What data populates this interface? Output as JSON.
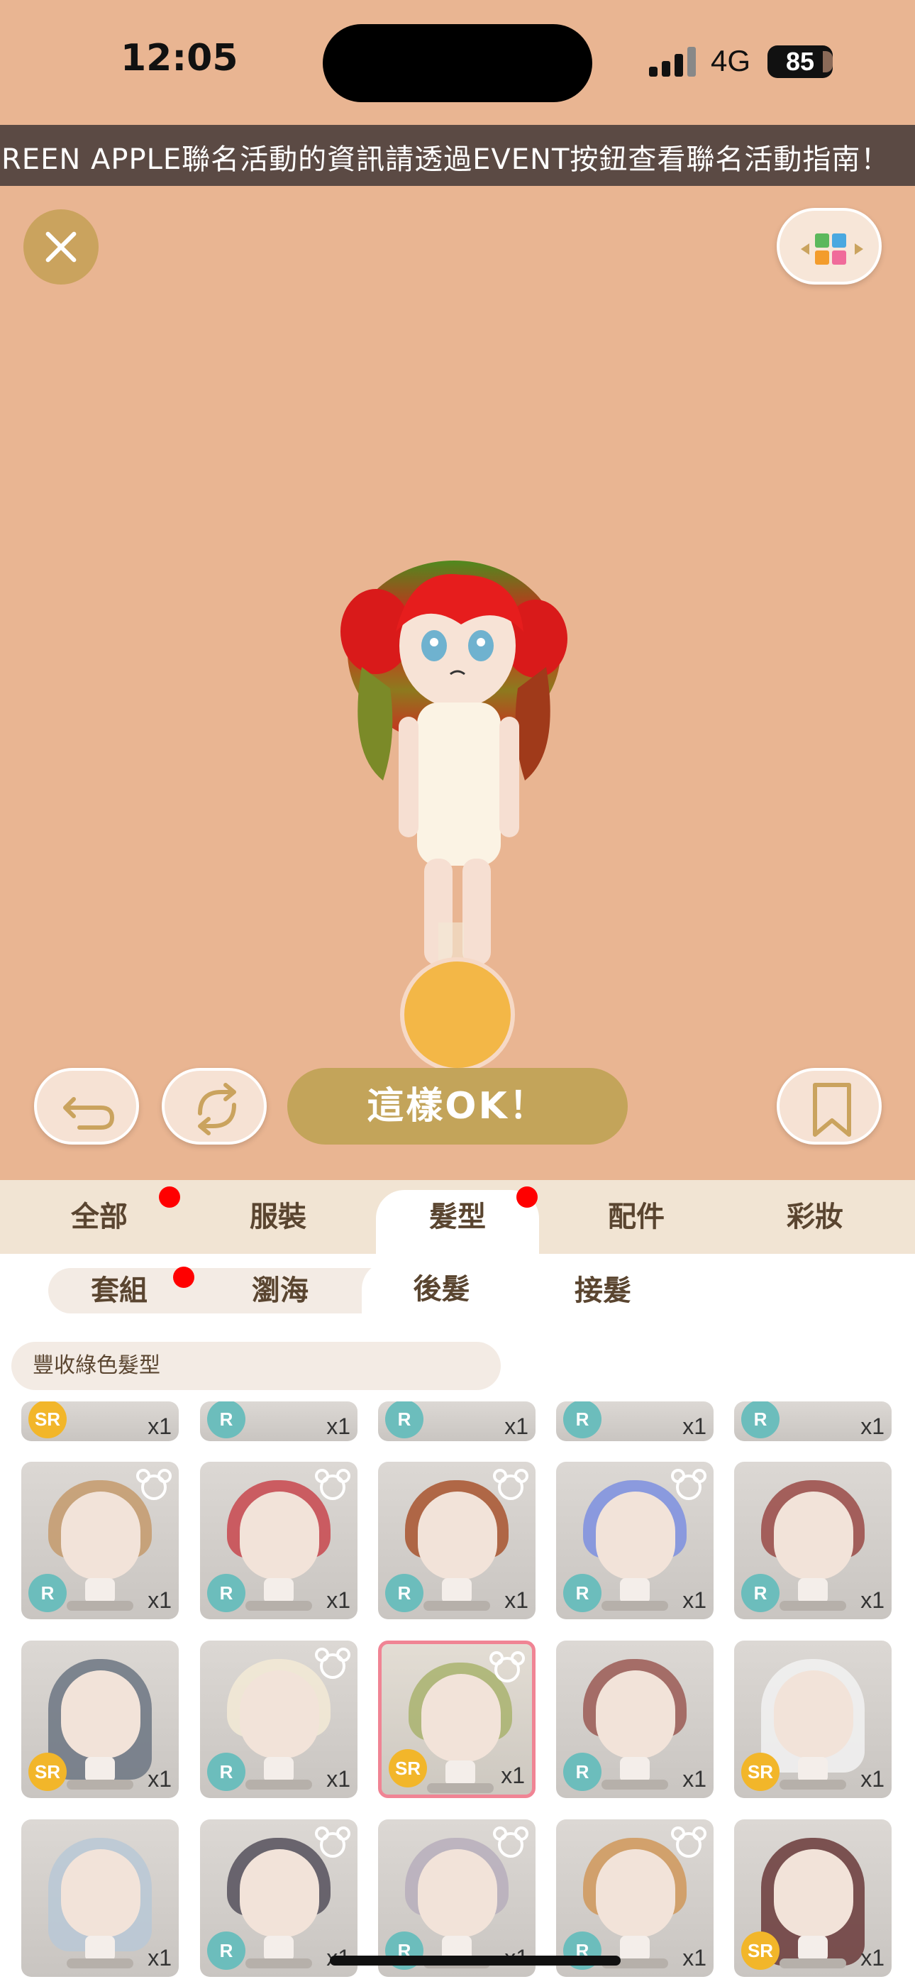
{
  "status_bar": {
    "time": "12:05",
    "network": "4G",
    "battery": "85"
  },
  "banner": {
    "text": "GREEN APPLE聯名活動的資訊請透過EVENT按鈕查看聯名活動指南！"
  },
  "toolbar": {
    "close_icon": "close-icon",
    "palette_icon": "color-grid-icon",
    "undo_icon": "undo-icon",
    "random_icon": "shuffle-icon",
    "ok_label": "這樣OK！",
    "bookmark_icon": "bookmark-icon"
  },
  "tabs": [
    {
      "label": "全部",
      "dot": true
    },
    {
      "label": "服裝",
      "dot": false
    },
    {
      "label": "髮型",
      "dot": true,
      "active": true
    },
    {
      "label": "配件",
      "dot": false
    },
    {
      "label": "彩妝",
      "dot": false
    }
  ],
  "subtabs": [
    {
      "label": "套組",
      "dot": true
    },
    {
      "label": "瀏海"
    },
    {
      "label": "後髮",
      "active": true
    },
    {
      "label": "接髮"
    }
  ],
  "filter": {
    "label": "豐收綠色髮型"
  },
  "colors": {
    "bg": "#e9b592",
    "accent": "#c3a45a",
    "rarity_r": "#6cbdbc",
    "rarity_sr": "#f2b62a",
    "selected_border": "#f08494",
    "notify": "#ff0000"
  },
  "items": [
    {
      "rarity": "SR",
      "qty": "x1"
    },
    {
      "rarity": "R",
      "qty": "x1"
    },
    {
      "rarity": "R",
      "qty": "x1"
    },
    {
      "rarity": "R",
      "qty": "x1"
    },
    {
      "rarity": "R",
      "qty": "x1"
    },
    {
      "rarity": "R",
      "qty": "x1"
    },
    {
      "rarity": "R",
      "qty": "x1"
    },
    {
      "rarity": "R",
      "qty": "x1"
    },
    {
      "rarity": "R",
      "qty": "x1"
    },
    {
      "rarity": "R",
      "qty": "x1"
    },
    {
      "rarity": "SR",
      "qty": "x1"
    },
    {
      "rarity": "R",
      "qty": "x1"
    },
    {
      "rarity": "SR",
      "qty": "x1",
      "selected": true
    },
    {
      "rarity": "R",
      "qty": "x1"
    },
    {
      "rarity": "SR",
      "qty": "x1"
    },
    {
      "rarity": "",
      "qty": "x1"
    },
    {
      "rarity": "R",
      "qty": "x1"
    },
    {
      "rarity": "R",
      "qty": "x1"
    },
    {
      "rarity": "R",
      "qty": "x1"
    },
    {
      "rarity": "SR",
      "qty": "x1"
    }
  ]
}
